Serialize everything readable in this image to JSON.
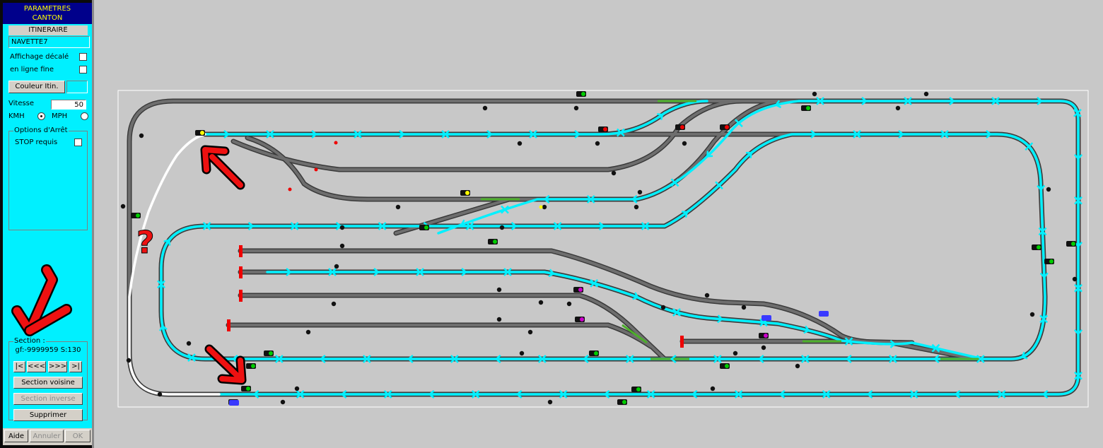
{
  "panel": {
    "title_line1": "PARAMETRES",
    "title_line2": "CANTON",
    "itinerary_label": "ITINERAIRE",
    "itinerary_name": "NAVETTE7",
    "offset_display_label": "Affichage décalé",
    "offset_display_checked": false,
    "thin_line_label": "en ligne fine",
    "thin_line_checked": false,
    "route_color_button": "Couleur Itin.",
    "route_color": "#00f0ff",
    "speed_label": "Vitesse",
    "speed_value": "50",
    "kmh_label": "KMH",
    "kmh_selected": true,
    "mph_label": "MPH",
    "mph_selected": false,
    "stop_options_group": "Options d'Arrêt",
    "stop_required_label": "STOP requis",
    "stop_required_checked": false,
    "section_group": "Section :",
    "section_value": "gf:-9999959 S:130",
    "nav_first": "|<",
    "nav_prev": "<<<",
    "nav_next": ">>>",
    "nav_last": ">|",
    "neighbor_section_button": "Section voisine",
    "reverse_section_button": "Section inverse",
    "delete_button": "Supprimer",
    "help_button": "Aide",
    "cancel_button": "Annuler",
    "ok_button": "OK"
  },
  "layout": {
    "question_mark": "?",
    "route_color": "#00f0ff",
    "active_section_color": "#ffffff",
    "annotation_color": "#dd1111",
    "track_color": "#6e6e6e"
  }
}
